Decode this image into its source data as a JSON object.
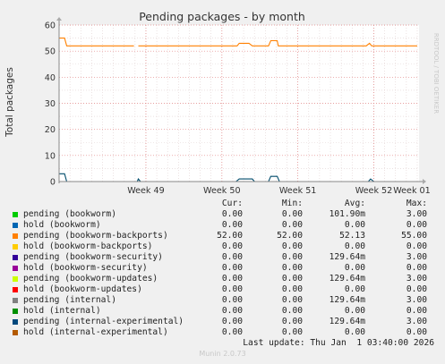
{
  "chart_data": {
    "type": "line",
    "title": "Pending packages - by month",
    "ylabel": "Total packages",
    "watermark": "RRDTOOL / TOBI OETIKER",
    "ylim": [
      0,
      60
    ],
    "yticks": [
      0,
      10,
      20,
      30,
      40,
      50,
      60
    ],
    "xlim": [
      0,
      33
    ],
    "xtick_positions": [
      8,
      15,
      22,
      29,
      35
    ],
    "xtick_labels": [
      "Week 49",
      "Week 50",
      "Week 51",
      "Week 52",
      "Week 01"
    ],
    "grid": true,
    "series": [
      {
        "name": "pending (bookworm-backports)",
        "color": "#ff8000",
        "points": [
          [
            0,
            55
          ],
          [
            0.5,
            55
          ],
          [
            0.7,
            52
          ],
          [
            6.9,
            52
          ],
          [
            7.0,
            null
          ],
          [
            7.3,
            52
          ],
          [
            16.4,
            52
          ],
          [
            16.6,
            53
          ],
          [
            17.5,
            53
          ],
          [
            17.8,
            52
          ],
          [
            19.3,
            52
          ],
          [
            19.5,
            54
          ],
          [
            20.1,
            54
          ],
          [
            20.2,
            52
          ],
          [
            28.3,
            52
          ],
          [
            28.6,
            53
          ],
          [
            28.8,
            52
          ],
          [
            46,
            52
          ]
        ]
      },
      {
        "name": "pending (internal-experimental)",
        "color": "#004b6b",
        "points": [
          [
            0,
            3
          ],
          [
            0.5,
            3
          ],
          [
            0.7,
            0
          ],
          [
            7.2,
            0
          ],
          [
            7.3,
            1
          ],
          [
            7.5,
            0
          ],
          [
            16.3,
            0
          ],
          [
            16.6,
            1
          ],
          [
            17.8,
            1
          ],
          [
            18.0,
            0
          ],
          [
            19.3,
            0
          ],
          [
            19.5,
            2
          ],
          [
            20.1,
            2
          ],
          [
            20.3,
            0
          ],
          [
            28.5,
            0
          ],
          [
            28.7,
            1
          ],
          [
            29.0,
            0
          ],
          [
            46,
            0
          ]
        ]
      }
    ],
    "legend_headers": [
      "Cur:",
      "Min:",
      "Avg:",
      "Max:"
    ],
    "legend": [
      {
        "name": "pending (bookworm)",
        "color": "#00cc00",
        "cur": "0.00",
        "min": "0.00",
        "avg": "101.90m",
        "max": "3.00"
      },
      {
        "name": "hold (bookworm)",
        "color": "#0066b3",
        "cur": "0.00",
        "min": "0.00",
        "avg": "0.00",
        "max": "0.00"
      },
      {
        "name": "pending (bookworm-backports)",
        "color": "#ff8000",
        "cur": "52.00",
        "min": "52.00",
        "avg": "52.13",
        "max": "55.00"
      },
      {
        "name": "hold (bookworm-backports)",
        "color": "#ffcc00",
        "cur": "0.00",
        "min": "0.00",
        "avg": "0.00",
        "max": "0.00"
      },
      {
        "name": "pending (bookworm-security)",
        "color": "#330099",
        "cur": "0.00",
        "min": "0.00",
        "avg": "129.64m",
        "max": "3.00"
      },
      {
        "name": "hold (bookworm-security)",
        "color": "#990099",
        "cur": "0.00",
        "min": "0.00",
        "avg": "0.00",
        "max": "0.00"
      },
      {
        "name": "pending (bookworm-updates)",
        "color": "#ccff00",
        "cur": "0.00",
        "min": "0.00",
        "avg": "129.64m",
        "max": "3.00"
      },
      {
        "name": "hold (bookworm-updates)",
        "color": "#ff0000",
        "cur": "0.00",
        "min": "0.00",
        "avg": "0.00",
        "max": "0.00"
      },
      {
        "name": "pending (internal)",
        "color": "#808080",
        "cur": "0.00",
        "min": "0.00",
        "avg": "129.64m",
        "max": "3.00"
      },
      {
        "name": "hold (internal)",
        "color": "#008f00",
        "cur": "0.00",
        "min": "0.00",
        "avg": "0.00",
        "max": "0.00"
      },
      {
        "name": "pending (internal-experimental)",
        "color": "#00487d",
        "cur": "0.00",
        "min": "0.00",
        "avg": "129.64m",
        "max": "3.00"
      },
      {
        "name": "hold (internal-experimental)",
        "color": "#b35a00",
        "cur": "0.00",
        "min": "0.00",
        "avg": "0.00",
        "max": "0.00"
      }
    ],
    "last_update": "Last update: Thu Jan  1 03:40:00 2026",
    "footer": "Munin 2.0.73"
  }
}
